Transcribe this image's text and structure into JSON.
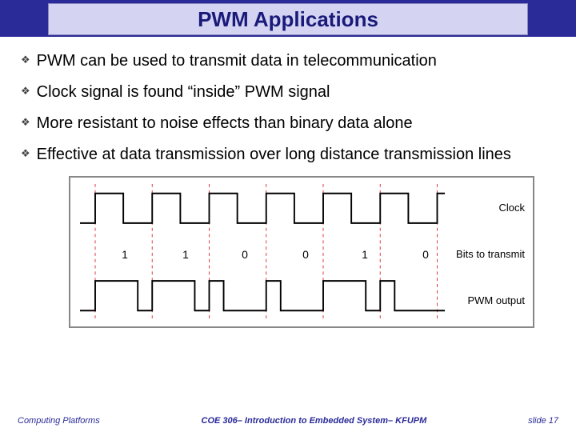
{
  "title": "PWM Applications",
  "bullets": [
    "PWM can be used to transmit data in telecommunication",
    "Clock signal is found “inside” PWM signal",
    "More resistant to noise effects than binary data alone",
    "Effective at data transmission over long distance transmission lines"
  ],
  "diagram": {
    "labels": {
      "clock": "Clock",
      "bits": "Bits to transmit",
      "pwm": "PWM output"
    },
    "bits": [
      "1",
      "1",
      "0",
      "0",
      "1",
      "0"
    ]
  },
  "footer": {
    "left": "Computing Platforms",
    "center": "COE 306– Introduction to Embedded System– KFUPM",
    "right": "slide 17"
  }
}
